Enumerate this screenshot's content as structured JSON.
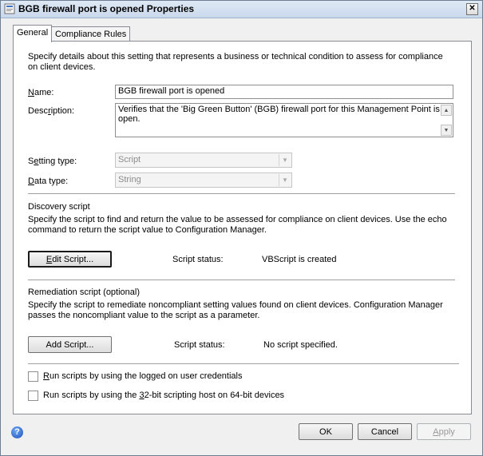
{
  "window": {
    "title": "BGB firewall port is opened Properties",
    "close_glyph": "✕"
  },
  "tabs": [
    {
      "label": "General",
      "active": true
    },
    {
      "label": "Compliance Rules",
      "active": false
    }
  ],
  "general": {
    "intro": "Specify details about this setting that represents a business or technical condition to assess for compliance on client devices.",
    "name_label_pre": "",
    "name_label_u": "N",
    "name_label_post": "ame:",
    "name_value": "BGB firewall port is opened",
    "desc_label_pre": "Desc",
    "desc_label_u": "r",
    "desc_label_post": "iption:",
    "desc_value": "Verifies that the 'Big Green Button' (BGB) firewall port for this Management Point is open.",
    "setting_type_label_pre": "S",
    "setting_type_label_u": "e",
    "setting_type_label_post": "tting type:",
    "setting_type_value": "Script",
    "data_type_label_pre": "",
    "data_type_label_u": "D",
    "data_type_label_post": "ata type:",
    "data_type_value": "String"
  },
  "discovery": {
    "heading": "Discovery script",
    "desc": "Specify the script to find and return the value to be assessed for compliance on client devices. Use the echo command to return the script value to Configuration Manager.",
    "button_pre": "",
    "button_u": "E",
    "button_post": "dit Script...",
    "status_label": "Script status:",
    "status_value": "VBScript is created"
  },
  "remediation": {
    "heading": "Remediation script (optional)",
    "desc": "Specify the script to remediate noncompliant setting values found on client devices. Configuration Manager passes the noncompliant value to the script as a parameter.",
    "button_pre": "Add Script...",
    "status_label": "Script status:",
    "status_value": "No script specified."
  },
  "options": {
    "run_logged_on_pre": "",
    "run_logged_on_u": "R",
    "run_logged_on_post": "un scripts by using the logged on user credentials",
    "run_logged_on_checked": false,
    "run_32bit_pre": "Run scripts by using the ",
    "run_32bit_u": "3",
    "run_32bit_post": "2-bit scripting host on 64-bit devices",
    "run_32bit_checked": false
  },
  "footer": {
    "help_glyph": "?",
    "ok": "OK",
    "cancel": "Cancel",
    "apply_pre": "",
    "apply_u": "A",
    "apply_post": "pply"
  },
  "icons": {
    "title_icon": "settings-icon",
    "combo_arrow": "▼",
    "scroll_up": "▲",
    "scroll_down": "▼"
  }
}
